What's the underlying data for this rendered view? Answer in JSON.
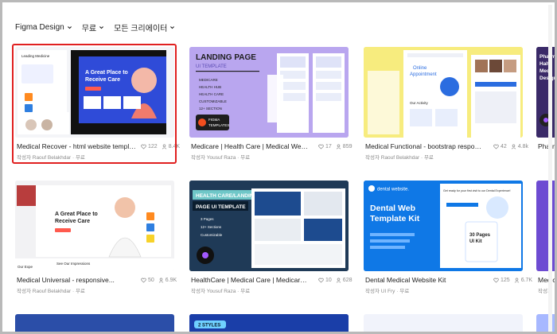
{
  "filters": [
    {
      "label": "Figma Design"
    },
    {
      "label": "무료"
    },
    {
      "label": "모든 크리에이터"
    }
  ],
  "cards": [
    {
      "title": "Medical Recover - html website templat...",
      "meta": "작성자 Raouf Belakhdar · 무료",
      "likes": "122",
      "users": "8.4K",
      "thumb": {
        "brand": "Leading Medicine",
        "headline": "A Great Place to Receive Care",
        "sub": "Our Team",
        "bg": "#f4f5f8",
        "accent": "#2f4bd8",
        "dark": "#111"
      }
    },
    {
      "title": "Medicare | Health Care | Medical Website...",
      "meta": "작성자 Yousuf Raza · 무료",
      "likes": "17",
      "users": "859",
      "thumb": {
        "line1": "LANDING PAGE",
        "line2": "UI TEMPLATE",
        "list": [
          "MEDICARE",
          "HEALTH HUB",
          "HEALTH CARE",
          "CUSTOMIZABLE",
          "12+ SECTION"
        ],
        "badge1": "FIGMA",
        "badge2": "TEMPLATES",
        "bg": "#b9a6ef"
      }
    },
    {
      "title": "Medical Functional - bootstrap responsi...",
      "meta": "작성자 Raouf Belakhdar · 무료",
      "likes": "42",
      "users": "4.8k",
      "thumb": {
        "line1": "Online",
        "line2": "Appointment",
        "sub": "Our Activity",
        "bg": "#f7ec7e"
      }
    },
    {
      "title": "Pharma",
      "meta": "",
      "likes": "",
      "users": "",
      "thumb": {
        "line1": "Pharm",
        "line2": "Halth",
        "line3": "Medi",
        "line4": "Design",
        "bg": "#3a2a68"
      }
    },
    {
      "title": "Medical Universal - responsive...",
      "meta": "작성자 Raouf Belakhdar · 무료",
      "likes": "50",
      "users": "6.9K",
      "thumb": {
        "headline": "A Great Place to Receive Care",
        "sub": "See Our Impressions",
        "bottom": "Our Expe",
        "bg": "#f2f2f4"
      }
    },
    {
      "title": "HealthCare | Medical Care | Medicare |...",
      "meta": "작성자 Yousuf Raza · 무료",
      "likes": "10",
      "users": "628",
      "thumb": {
        "line1": "HEALTH CARE/LANDING",
        "line2": "PAGE UI TEMPLATE",
        "list": [
          "3 Pages",
          "12+ Sections",
          "Customizable"
        ],
        "bg": "#1f3a57"
      }
    },
    {
      "title": "Dental Medical Website Kit",
      "meta": "작성자 UI Fry · 무료",
      "likes": "125",
      "users": "6.7K",
      "thumb": {
        "brand": "dental website.",
        "line1": "Dental Web",
        "line2": "Template Kit",
        "ready": "Get ready for your first visit to our Dental Experience!",
        "pages": "30 Pages",
        "kit": "UI Kit",
        "bg": "#0f78e6"
      }
    },
    {
      "title": "Medica",
      "meta": "작성자",
      "likes": "",
      "users": "",
      "thumb": {
        "bg": "#6d4bd2"
      }
    }
  ],
  "bottomRow": {
    "chip": "2 STYLES",
    "bg1": "#2b4ea8",
    "bg2": "#1a3ea8"
  },
  "colors": {
    "selection": "#e02020",
    "text": "#1e1e1e",
    "muted": "#8a8a8a"
  },
  "icons": [
    "chevron-down-icon",
    "heart-icon",
    "user-icon"
  ]
}
